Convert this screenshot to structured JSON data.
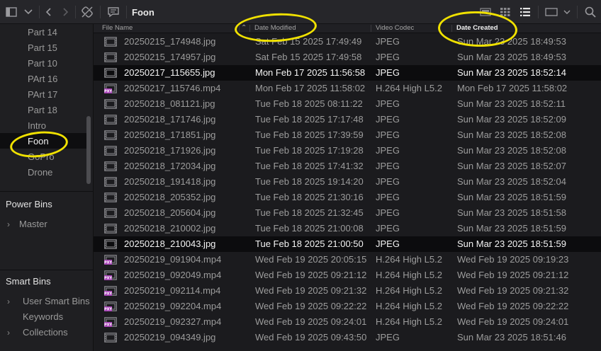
{
  "toolbar": {
    "breadcrumb": "Foon",
    "icons": [
      "sidebar-toggle-icon",
      "chevron-down-icon",
      "chevron-left-icon",
      "chevron-right-icon",
      "unlink-icon",
      "metadata-icon",
      "filmstrip-view-icon",
      "thumbnail-view-icon",
      "list-view-icon",
      "monitor-icon",
      "search-icon"
    ]
  },
  "sidebar": {
    "bins": [
      "Part 14",
      "Part 15",
      "Part 10",
      "PArt 16",
      "PArt 17",
      "Part 18",
      "Intro",
      "Foon",
      "GoPro",
      "Drone"
    ],
    "selected_bin": "Foon",
    "power_bins": {
      "title": "Power Bins",
      "items": [
        "Master"
      ]
    },
    "smart_bins": {
      "title": "Smart Bins",
      "items": [
        "User Smart Bins",
        "Keywords",
        "Collections"
      ]
    }
  },
  "table": {
    "columns": [
      "File Name",
      "Date Modified",
      "Video Codec",
      "Date Created"
    ],
    "sorted_column": "Date Created",
    "rows": [
      {
        "type": "image",
        "name": "20250215_174948.jpg",
        "modified": "Sat Feb 15 2025 17:49:49",
        "codec": "JPEG",
        "created": "Sun Mar 23 2025 18:49:53",
        "selected": false
      },
      {
        "type": "image",
        "name": "20250215_174957.jpg",
        "modified": "Sat Feb 15 2025 17:49:58",
        "codec": "JPEG",
        "created": "Sun Mar 23 2025 18:49:53",
        "selected": false
      },
      {
        "type": "image",
        "name": "20250217_115655.jpg",
        "modified": "Mon Feb 17 2025 11:56:58",
        "codec": "JPEG",
        "created": "Sun Mar 23 2025 18:52:14",
        "selected": true
      },
      {
        "type": "video",
        "name": "20250217_115746.mp4",
        "modified": "Mon Feb 17 2025 11:58:02",
        "codec": "H.264 High L5.2",
        "created": "Mon Feb 17 2025 11:58:02",
        "selected": false
      },
      {
        "type": "image",
        "name": "20250218_081121.jpg",
        "modified": "Tue Feb 18 2025 08:11:22",
        "codec": "JPEG",
        "created": "Sun Mar 23 2025 18:52:11",
        "selected": false
      },
      {
        "type": "image",
        "name": "20250218_171746.jpg",
        "modified": "Tue Feb 18 2025 17:17:48",
        "codec": "JPEG",
        "created": "Sun Mar 23 2025 18:52:09",
        "selected": false
      },
      {
        "type": "image",
        "name": "20250218_171851.jpg",
        "modified": "Tue Feb 18 2025 17:39:59",
        "codec": "JPEG",
        "created": "Sun Mar 23 2025 18:52:08",
        "selected": false
      },
      {
        "type": "image",
        "name": "20250218_171926.jpg",
        "modified": "Tue Feb 18 2025 17:19:28",
        "codec": "JPEG",
        "created": "Sun Mar 23 2025 18:52:08",
        "selected": false
      },
      {
        "type": "image",
        "name": "20250218_172034.jpg",
        "modified": "Tue Feb 18 2025 17:41:32",
        "codec": "JPEG",
        "created": "Sun Mar 23 2025 18:52:07",
        "selected": false
      },
      {
        "type": "image",
        "name": "20250218_191418.jpg",
        "modified": "Tue Feb 18 2025 19:14:20",
        "codec": "JPEG",
        "created": "Sun Mar 23 2025 18:52:04",
        "selected": false
      },
      {
        "type": "image",
        "name": "20250218_205352.jpg",
        "modified": "Tue Feb 18 2025 21:30:16",
        "codec": "JPEG",
        "created": "Sun Mar 23 2025 18:51:59",
        "selected": false
      },
      {
        "type": "image",
        "name": "20250218_205604.jpg",
        "modified": "Tue Feb 18 2025 21:32:45",
        "codec": "JPEG",
        "created": "Sun Mar 23 2025 18:51:58",
        "selected": false
      },
      {
        "type": "image",
        "name": "20250218_210002.jpg",
        "modified": "Tue Feb 18 2025 21:00:08",
        "codec": "JPEG",
        "created": "Sun Mar 23 2025 18:51:59",
        "selected": false
      },
      {
        "type": "image",
        "name": "20250218_210043.jpg",
        "modified": "Tue Feb 18 2025 21:00:50",
        "codec": "JPEG",
        "created": "Sun Mar 23 2025 18:51:59",
        "selected": true
      },
      {
        "type": "video",
        "name": "20250219_091904.mp4",
        "modified": "Wed Feb 19 2025 20:05:15",
        "codec": "H.264 High L5.2",
        "created": "Wed Feb 19 2025 09:19:23",
        "selected": false
      },
      {
        "type": "video",
        "name": "20250219_092049.mp4",
        "modified": "Wed Feb 19 2025 09:21:12",
        "codec": "H.264 High L5.2",
        "created": "Wed Feb 19 2025 09:21:12",
        "selected": false
      },
      {
        "type": "video",
        "name": "20250219_092114.mp4",
        "modified": "Wed Feb 19 2025 09:21:32",
        "codec": "H.264 High L5.2",
        "created": "Wed Feb 19 2025 09:21:32",
        "selected": false
      },
      {
        "type": "video",
        "name": "20250219_092204.mp4",
        "modified": "Wed Feb 19 2025 09:22:22",
        "codec": "H.264 High L5.2",
        "created": "Wed Feb 19 2025 09:22:22",
        "selected": false
      },
      {
        "type": "video",
        "name": "20250219_092327.mp4",
        "modified": "Wed Feb 19 2025 09:24:01",
        "codec": "H.264 High L5.2",
        "created": "Wed Feb 19 2025 09:24:01",
        "selected": false
      },
      {
        "type": "image",
        "name": "20250219_094349.jpg",
        "modified": "Wed Feb 19 2025 09:43:50",
        "codec": "JPEG",
        "created": "Sun Mar 23 2025 18:51:46",
        "selected": false
      }
    ]
  },
  "annotation_color": "#f0e100",
  "video_badge_color": "#a63fb6"
}
